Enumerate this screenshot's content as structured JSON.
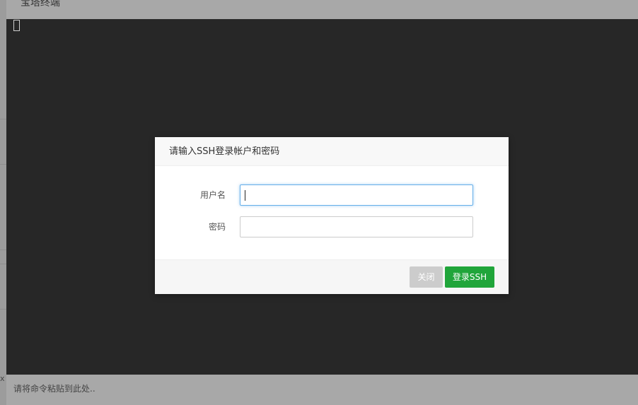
{
  "window": {
    "title": "宝塔终端"
  },
  "terminal": {
    "background": "#272727",
    "cursor_icon": "block-cursor"
  },
  "command_bar": {
    "placeholder": "请将命令粘贴到此处.."
  },
  "left_strip": {
    "close_mark": "x"
  },
  "dialog": {
    "title": "请输入SSH登录帐户和密码",
    "username": {
      "label": "用户名",
      "value": ""
    },
    "password": {
      "label": "密码",
      "value": ""
    },
    "buttons": {
      "close_label": "关闭",
      "login_label": "登录SSH"
    }
  },
  "colors": {
    "accent_green": "#20a53a",
    "focus_blue": "#66afe9",
    "disabled_gray": "#cccccc"
  }
}
